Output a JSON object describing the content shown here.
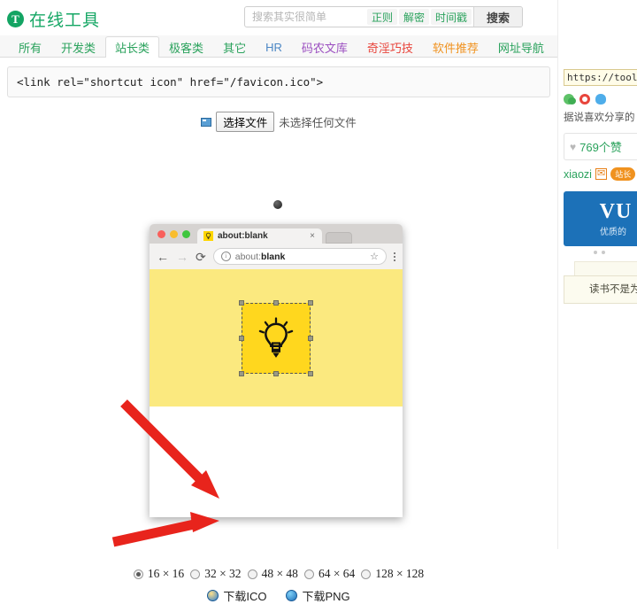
{
  "header": {
    "logo_letter": "T",
    "logo_text": "在线工具",
    "search": {
      "placeholder": "搜索其实很简单",
      "value": "",
      "tags": [
        "正则",
        "解密",
        "时间戳"
      ],
      "button_label": "搜索"
    }
  },
  "nav": {
    "items": [
      {
        "label": "所有",
        "color": "#2aa25c",
        "active": false
      },
      {
        "label": "开发类",
        "color": "#2aa25c",
        "active": false
      },
      {
        "label": "站长类",
        "color": "#2aa25c",
        "active": true
      },
      {
        "label": "极客类",
        "color": "#2aa25c",
        "active": false
      },
      {
        "label": "其它",
        "color": "#2aa25c",
        "active": false
      },
      {
        "label": "HR",
        "color": "#4b86c4",
        "active": false
      },
      {
        "label": "码农文库",
        "color": "#9b4fc0",
        "active": false
      },
      {
        "label": "奇淫巧技",
        "color": "#e8453c",
        "active": false
      },
      {
        "label": "软件推荐",
        "color": "#f0921f",
        "active": false
      },
      {
        "label": "网址导航",
        "color": "#2aa25c",
        "active": false
      }
    ]
  },
  "main": {
    "code_snippet": "<link rel=\"shortcut icon\" href=\"/favicon.ico\">",
    "file_input": {
      "button_label": "选择文件",
      "status_text": "未选择任何文件"
    },
    "preview": {
      "tab_title": "about:blank",
      "tab_close": "×",
      "url_prefix": "about:",
      "url_bold": "blank",
      "back_icon": "←",
      "forward_icon": "→",
      "reload_icon": "⟳",
      "star_icon": "☆",
      "favicon_glyph": "💡",
      "canvas_color": "#fbe97f",
      "selection_color": "#ffd71e"
    },
    "sizes": [
      {
        "label": "16 × 16",
        "selected": true
      },
      {
        "label": "32 × 32",
        "selected": false
      },
      {
        "label": "48 × 48",
        "selected": false
      },
      {
        "label": "64 × 64",
        "selected": false
      },
      {
        "label": "128 × 128",
        "selected": false
      }
    ],
    "downloads": [
      {
        "label": "下载ICO",
        "icon": "ico-icon"
      },
      {
        "label": "下载PNG",
        "icon": "png-icon"
      }
    ]
  },
  "sidebar": {
    "url_value": "https://tool.lu",
    "social": [
      "wechat-icon",
      "weibo-icon",
      "qq-icon"
    ],
    "share_text": "据说喜欢分享的",
    "like_count": "769个赞",
    "heart_icon": "♥",
    "author": "xiaozi",
    "mail_icon": "✉",
    "author_badge": "站长",
    "ad_title": "VU",
    "ad_sub": "优质的",
    "quote": "　　读书不是为\n不是为了轻信和\n考和权衡。"
  },
  "annotations": {
    "arrow_color": "#e8241c",
    "arrows": [
      {
        "name": "arrow-to-32x32"
      },
      {
        "name": "arrow-to-download-ico"
      }
    ]
  }
}
